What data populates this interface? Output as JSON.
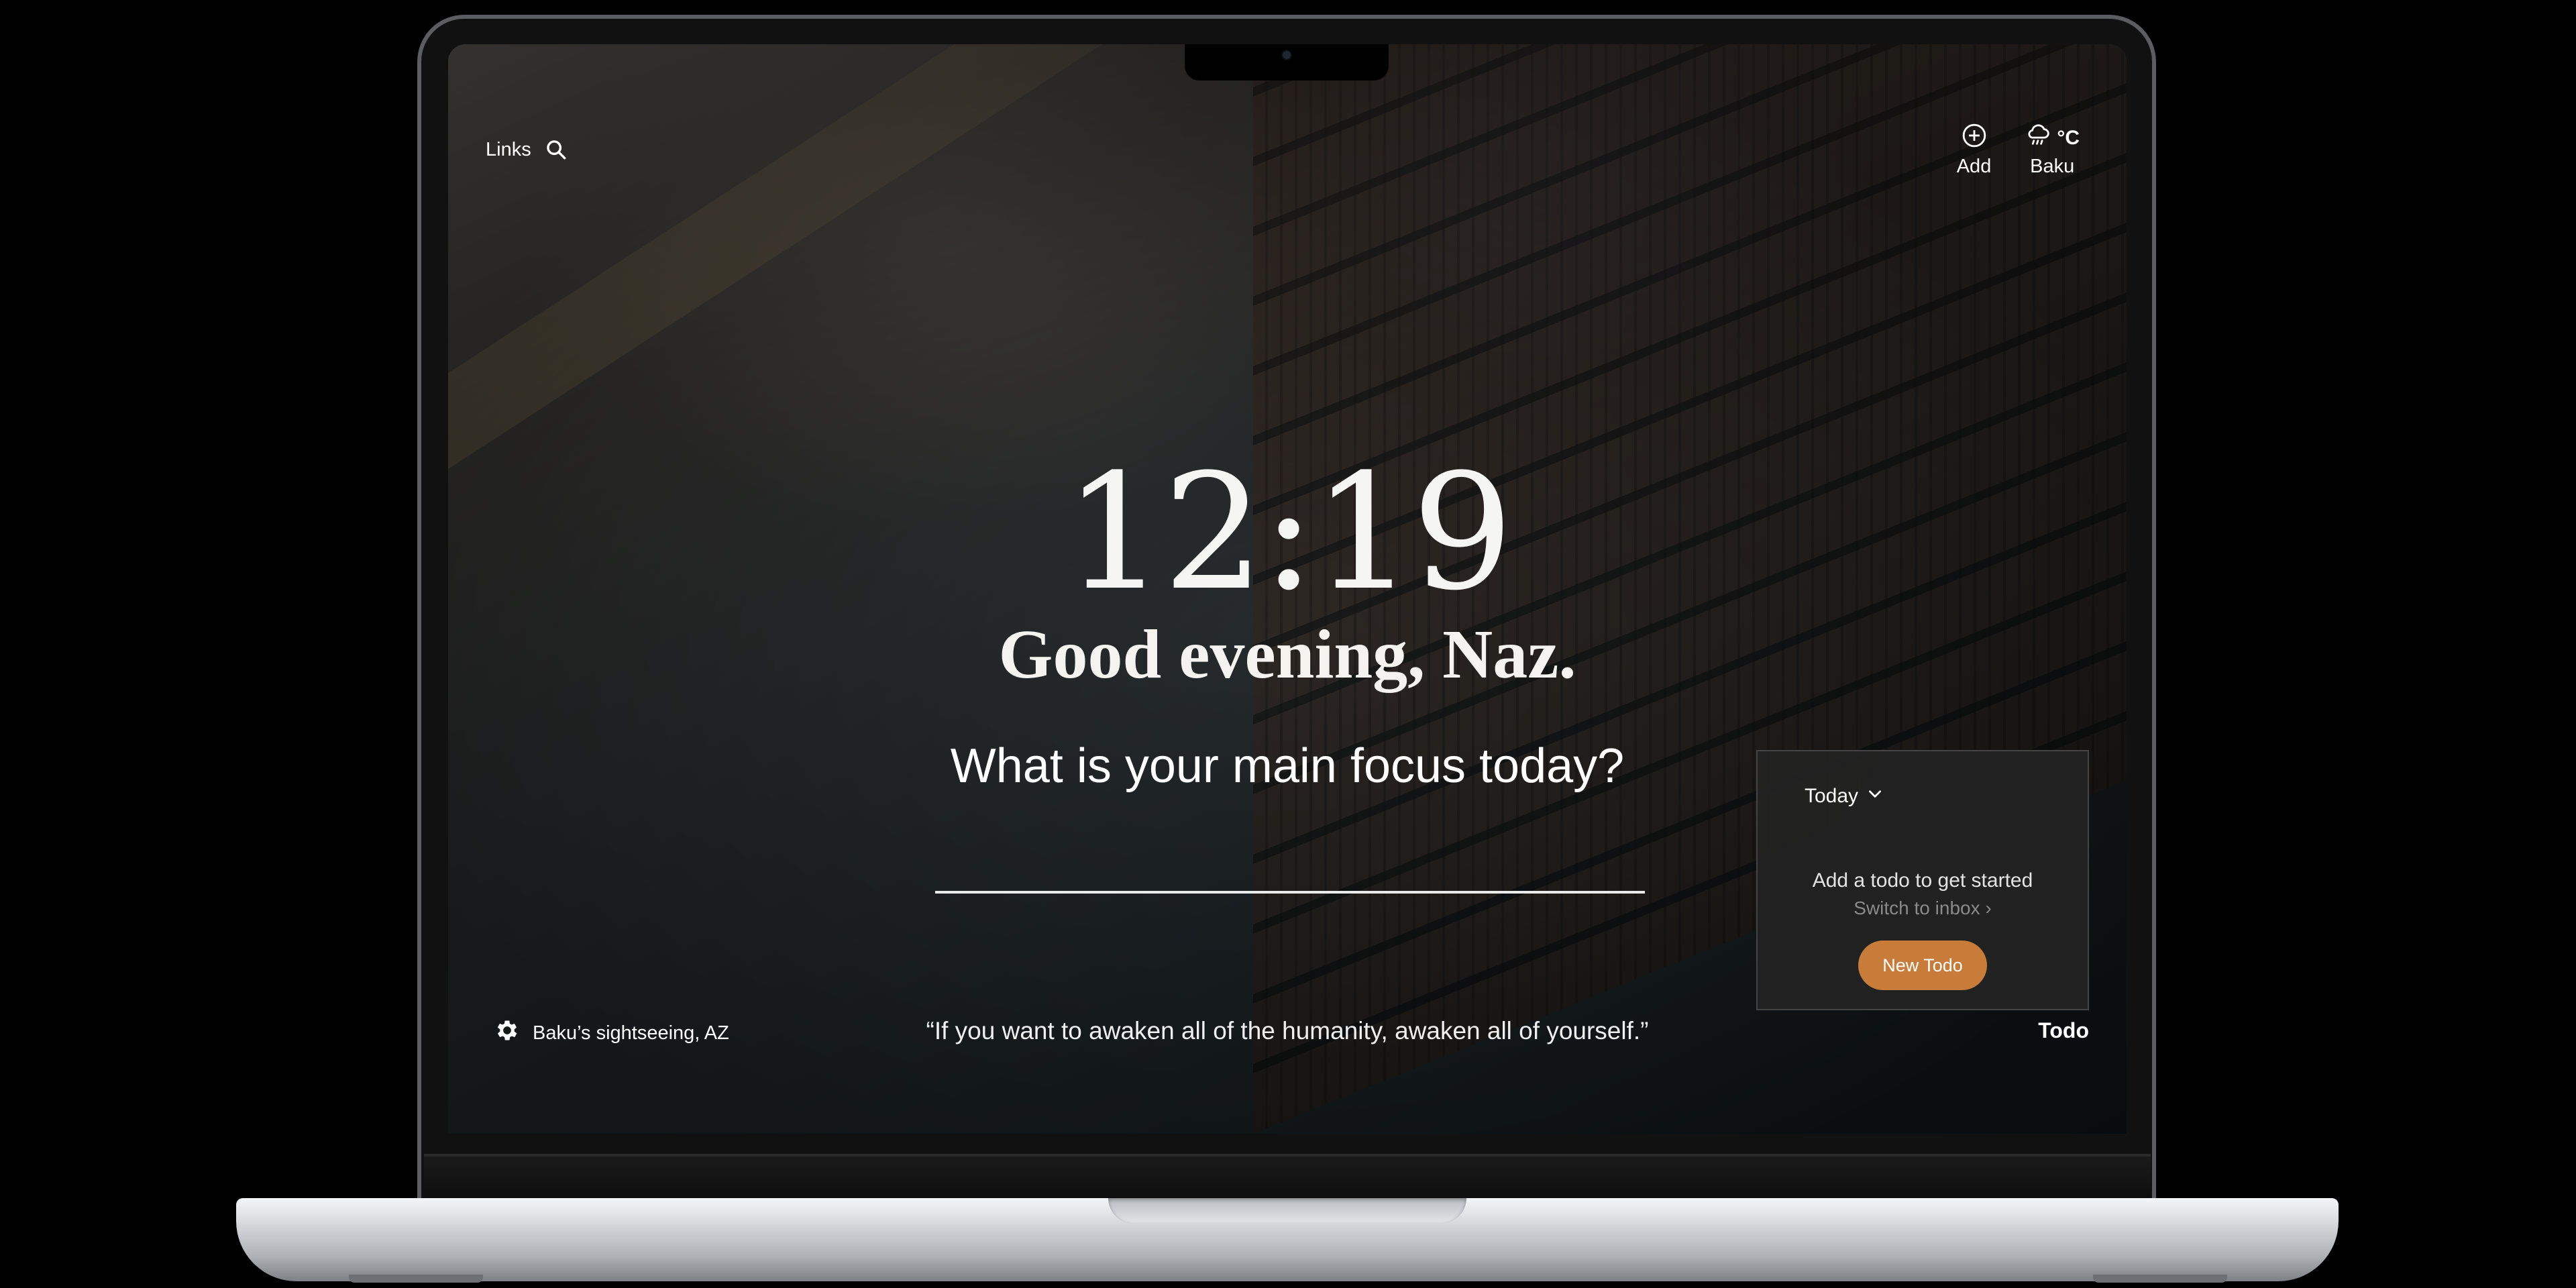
{
  "top_left": {
    "links_label": "Links",
    "search_icon": "search-icon"
  },
  "top_right": {
    "add_label": "Add",
    "add_icon": "plus-circle-icon",
    "weather_unit": "°C",
    "weather_icon": "cloud-rain-icon",
    "weather_location": "Baku"
  },
  "center": {
    "time": "12:19",
    "greeting": "Good evening, Naz.",
    "focus_question": "What is your main focus today?",
    "focus_input_value": ""
  },
  "todo_panel": {
    "list_selector": "Today",
    "empty_message": "Add a todo to get started",
    "switch_link": "Switch to inbox",
    "new_todo_button": "New Todo",
    "accent_color": "#c77c3a"
  },
  "bottom": {
    "photo_location": "Baku’s sightseeing, AZ",
    "settings_icon": "gear-icon",
    "quote": "“If you want to awaken all of the humanity, awaken all of yourself.”",
    "todo_label": "Todo"
  }
}
